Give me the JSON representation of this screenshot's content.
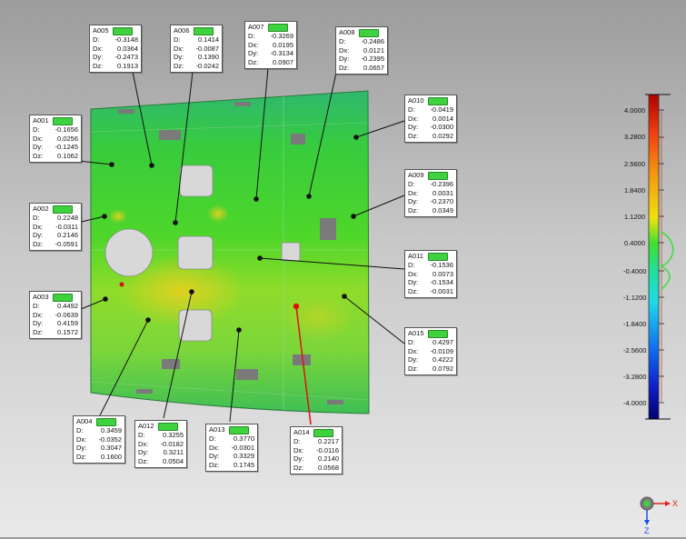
{
  "callouts": [
    {
      "id": "A001",
      "D": "-0.1656",
      "Dx": "0.0256",
      "Dy": "-0.1245",
      "Dz": "0.1062"
    },
    {
      "id": "A002",
      "D": "0.2248",
      "Dx": "-0.0311",
      "Dy": "0.2146",
      "Dz": "-0.0591"
    },
    {
      "id": "A003",
      "D": "0.4492",
      "Dx": "-0.0639",
      "Dy": "0.4159",
      "Dz": "0.1572"
    },
    {
      "id": "A004",
      "D": "0.3459",
      "Dx": "-0.0352",
      "Dy": "0.3047",
      "Dz": "0.1600"
    },
    {
      "id": "A005",
      "D": "-0.3148",
      "Dx": "0.0364",
      "Dy": "-0.2473",
      "Dz": "0.1913"
    },
    {
      "id": "A006",
      "D": "0.1414",
      "Dx": "-0.0087",
      "Dy": "0.1390",
      "Dz": "-0.0242"
    },
    {
      "id": "A007",
      "D": "-0.3269",
      "Dx": "0.0195",
      "Dy": "-0.3134",
      "Dz": "0.0907"
    },
    {
      "id": "A008",
      "D": "-0.2486",
      "Dx": "0.0121",
      "Dy": "-0.2395",
      "Dz": "0.0657"
    },
    {
      "id": "A009",
      "D": "-0.2396",
      "Dx": "0.0031",
      "Dy": "-0.2370",
      "Dz": "0.0349"
    },
    {
      "id": "A010",
      "D": "-0.0419",
      "Dx": "0.0014",
      "Dy": "-0.0300",
      "Dz": "0.0292"
    },
    {
      "id": "A011",
      "D": "-0.1536",
      "Dx": "0.0073",
      "Dy": "-0.1534",
      "Dz": "-0.0031"
    },
    {
      "id": "A012",
      "D": "0.3255",
      "Dx": "-0.0182",
      "Dy": "0.3211",
      "Dz": "0.0504"
    },
    {
      "id": "A013",
      "D": "0.3770",
      "Dx": "-0.0301",
      "Dy": "0.3329",
      "Dz": "0.1745"
    },
    {
      "id": "A014",
      "D": "0.2217",
      "Dx": "-0.0116",
      "Dy": "0.2140",
      "Dz": "0.0568"
    },
    {
      "id": "A015",
      "D": "0.4297",
      "Dx": "-0.0109",
      "Dy": "0.4222",
      "Dz": "0.0792"
    }
  ],
  "field_labels": {
    "D": "D:",
    "Dx": "Dx:",
    "Dy": "Dy:",
    "Dz": "Dz:"
  },
  "flag_color": "#3ed23e",
  "highlight_color": "#e01010",
  "color_scale": {
    "ticks": [
      "4.0000",
      "3.2800",
      "2.5600",
      "1.8400",
      "1.1200",
      "0.4000",
      "-0.4000",
      "-1.1200",
      "-1.8400",
      "-2.5600",
      "-3.2800",
      "-4.0000"
    ]
  },
  "triad": {
    "x_label": "X",
    "z_label": "Z",
    "x_color": "#e02020",
    "z_color": "#2050e0"
  }
}
